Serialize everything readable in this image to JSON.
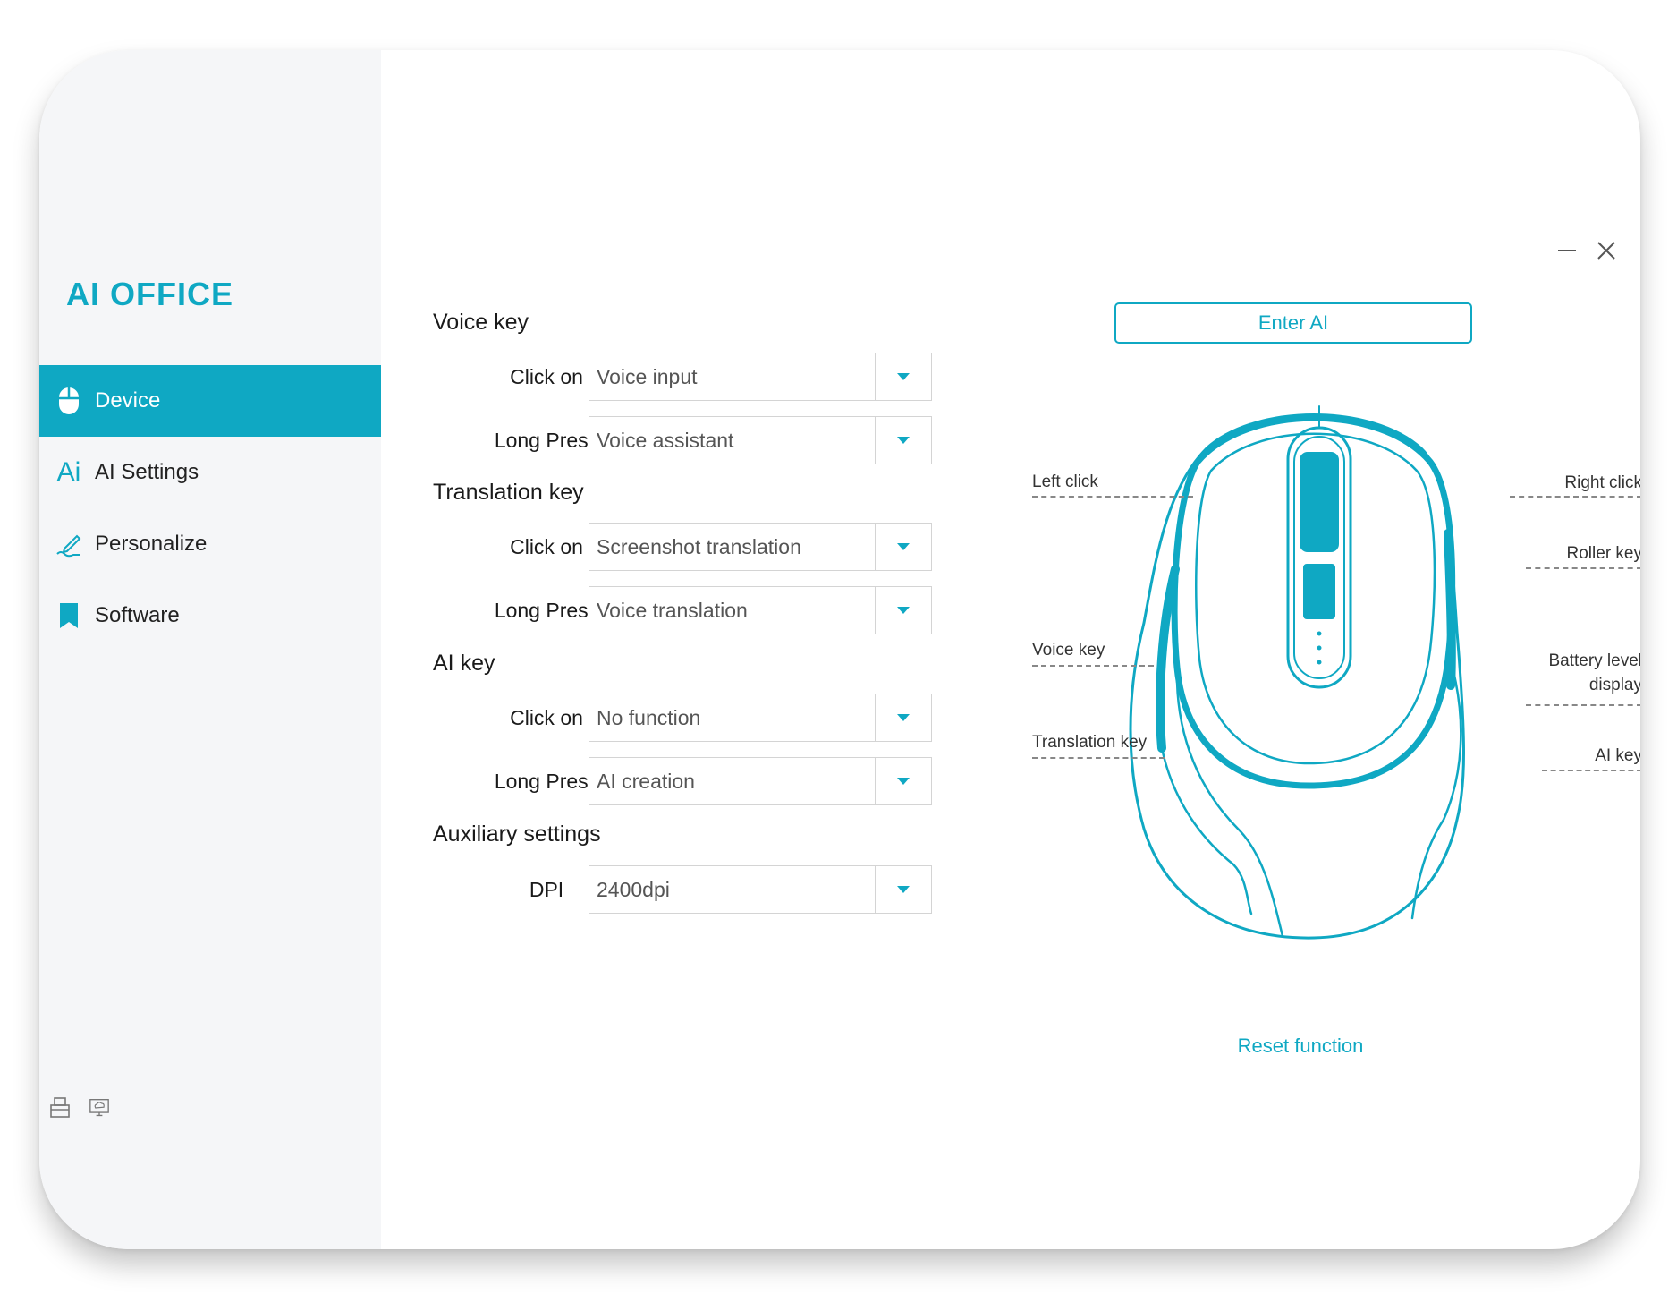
{
  "app": {
    "logo": "AI OFFICE"
  },
  "sidebar": {
    "items": [
      {
        "label": "Device",
        "icon": "mouse-icon",
        "active": true
      },
      {
        "label": "AI Settings",
        "icon": "ai-icon",
        "active": false
      },
      {
        "label": "Personalize",
        "icon": "pen-icon",
        "active": false
      },
      {
        "label": "Software",
        "icon": "bookmark-icon",
        "active": false
      }
    ],
    "footer_icons": [
      "printer-icon",
      "cloud-monitor-icon"
    ],
    "ai_icon_text": "Ai"
  },
  "window_controls": {
    "minimize": "minimize-icon",
    "close": "close-icon"
  },
  "settings": {
    "voice_key": {
      "title": "Voice key",
      "click_label": "Click on",
      "click_value": "Voice input",
      "long_label": "Long Press",
      "long_value": "Voice assistant"
    },
    "translation_key": {
      "title": "Translation key",
      "click_label": "Click on",
      "click_value": "Screenshot translation",
      "long_label": "Long Press",
      "long_value": "Voice translation"
    },
    "ai_key": {
      "title": "AI key",
      "click_label": "Click on",
      "click_value": "No function",
      "long_label": "Long Press",
      "long_value": "AI creation"
    },
    "auxiliary": {
      "title": "Auxiliary settings",
      "dpi_label": "DPI",
      "dpi_value": "2400dpi"
    }
  },
  "mouse_panel": {
    "enter_ai": "Enter AI",
    "callouts": {
      "left_click": "Left click",
      "right_click": "Right click",
      "roller_key": "Roller key",
      "voice_key": "Voice key",
      "battery_level_line1": "Battery level",
      "battery_level_line2": "display",
      "translation_key": "Translation key",
      "ai_key": "AI key"
    },
    "reset": "Reset function"
  },
  "colors": {
    "accent": "#0fa8c3",
    "sidebar_bg": "#f5f6f8"
  }
}
